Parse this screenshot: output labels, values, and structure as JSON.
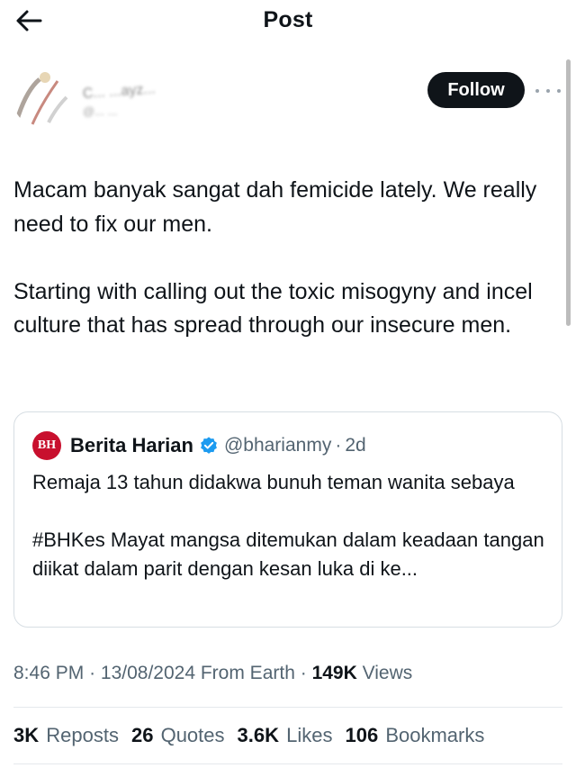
{
  "header": {
    "title": "Post",
    "back_icon": "arrow-left-icon"
  },
  "author": {
    "name": "C... ...ayz...",
    "handle": "@... ...",
    "follow_label": "Follow",
    "more_icon": "more-horizontal-icon"
  },
  "post": {
    "paragraphs": [
      "Macam banyak sangat dah femicide lately. We really need to fix our men.",
      "Starting with calling out the toxic misogyny and incel culture that has spread through our insecure men."
    ]
  },
  "quote": {
    "logo_text": "BH",
    "name": "Berita Harian",
    "handle": "@bharianmy",
    "separator": "·",
    "time": "2d",
    "paragraphs": [
      "Remaja 13 tahun didakwa bunuh teman wanita sebaya",
      "#BHKes Mayat mangsa ditemukan dalam keadaan tangan diikat dalam parit dengan kesan luka di ke..."
    ],
    "brand_color": "#c8102e",
    "verified_color": "#1d9bf0"
  },
  "meta": {
    "time": "8:46 PM",
    "sep1": "·",
    "date": "13/08/2024",
    "source": "From Earth",
    "sep2": "·",
    "views_count": "149K",
    "views_label": "Views"
  },
  "stats": [
    {
      "count": "3K",
      "label": "Reposts"
    },
    {
      "count": "26",
      "label": "Quotes"
    },
    {
      "count": "3.6K",
      "label": "Likes"
    },
    {
      "count": "106",
      "label": "Bookmarks"
    }
  ],
  "colors": {
    "text": "#0f1419",
    "secondary": "#536471",
    "border": "#d7dee3"
  }
}
